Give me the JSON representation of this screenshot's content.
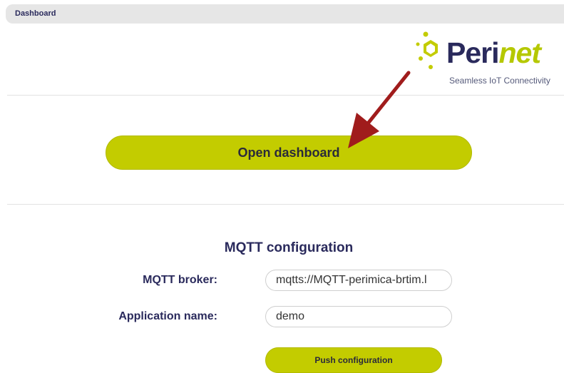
{
  "tab": {
    "label": "Dashboard"
  },
  "logo": {
    "name_part1": "Peri",
    "name_part2": "net",
    "tagline": "Seamless IoT Connectivity"
  },
  "dashboard": {
    "open_button_label": "Open dashboard"
  },
  "mqtt": {
    "title": "MQTT configuration",
    "broker_label": "MQTT broker:",
    "broker_value": "mqtts://MQTT-perimica-brtim.l",
    "app_label": "Application name:",
    "app_value": "demo",
    "push_button_label": "Push configuration"
  },
  "colors": {
    "accent": "#c3cc00",
    "text": "#2a2a5c",
    "arrow": "#a01c1c"
  }
}
